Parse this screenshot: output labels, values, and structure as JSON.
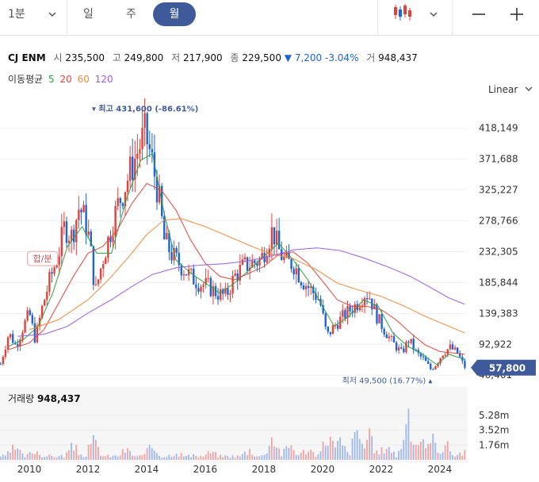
{
  "toolbar": {
    "interval_label": "1분",
    "periods": [
      "일",
      "주",
      "월"
    ],
    "active_period": "월"
  },
  "stock": {
    "name": "CJ ENM",
    "open_label": "시",
    "open": "235,500",
    "high_label": "고",
    "high": "249,800",
    "low_label": "저",
    "low": "217,900",
    "close_label": "종",
    "close": "229,500",
    "change": "▼ 7,200",
    "change_pct": "-3.04%",
    "volume_label": "거",
    "volume": "948,437"
  },
  "moving_average": {
    "label": "이동평균",
    "periods": [
      {
        "value": "5",
        "color": "#2e9e3e"
      },
      {
        "value": "20",
        "color": "#e0433c"
      },
      {
        "value": "60",
        "color": "#f2883a"
      },
      {
        "value": "120",
        "color": "#9a5ae0"
      }
    ]
  },
  "scale_label": "Linear",
  "colors": {
    "up": "#e0433c",
    "down": "#1e63d8",
    "current": "#3f5a9a",
    "volume_up": "#f0a4a4",
    "volume_down": "#9cb8ee"
  },
  "chart_data": {
    "type": "candlestick",
    "y_ticks": [
      "418,149",
      "371,688",
      "325,227",
      "278,766",
      "232,305",
      "185,844",
      "139,383",
      "92,922",
      "46,461"
    ],
    "y_tick_values": [
      418149,
      371688,
      325227,
      278766,
      232305,
      185844,
      139383,
      92922,
      46461
    ],
    "ylim": [
      36000,
      450000
    ],
    "x_ticks": [
      "2010",
      "2012",
      "2014",
      "2016",
      "2018",
      "2020",
      "2022",
      "2024"
    ],
    "x_tick_years": [
      2010,
      2012,
      2014,
      2016,
      2018,
      2020,
      2022,
      2024
    ],
    "xlim": [
      2009.0,
      2024.95
    ],
    "current_price": "57,800",
    "current_value": 57800,
    "max_annotation": "최고 431,600 (-86.61%)",
    "max_point": {
      "year": 2013.95,
      "value": 431600
    },
    "min_annotation": "최저 49,500 (16.77%)",
    "min_point": {
      "year": 2023.8,
      "value": 49500
    },
    "event_label": "합/분",
    "event_point": {
      "year": 2010.45,
      "value": 222000
    },
    "close_path": [
      [
        2009.0,
        60000
      ],
      [
        2009.3,
        110000
      ],
      [
        2009.55,
        90000
      ],
      [
        2009.8,
        120000
      ],
      [
        2010.0,
        140000
      ],
      [
        2010.2,
        100000
      ],
      [
        2010.45,
        150000
      ],
      [
        2010.7,
        190000
      ],
      [
        2011.0,
        230000
      ],
      [
        2011.2,
        270000
      ],
      [
        2011.45,
        255000
      ],
      [
        2011.7,
        300000
      ],
      [
        2011.9,
        280000
      ],
      [
        2012.05,
        250000
      ],
      [
        2012.25,
        170000
      ],
      [
        2012.5,
        220000
      ],
      [
        2012.75,
        260000
      ],
      [
        2013.0,
        300000
      ],
      [
        2013.25,
        330000
      ],
      [
        2013.5,
        360000
      ],
      [
        2013.75,
        390000
      ],
      [
        2013.95,
        410000
      ],
      [
        2014.15,
        375000
      ],
      [
        2014.4,
        320000
      ],
      [
        2014.6,
        250000
      ],
      [
        2014.9,
        225000
      ],
      [
        2015.2,
        210000
      ],
      [
        2015.5,
        195000
      ],
      [
        2015.8,
        185000
      ],
      [
        2016.1,
        180000
      ],
      [
        2016.4,
        170000
      ],
      [
        2016.7,
        165000
      ],
      [
        2017.0,
        195000
      ],
      [
        2017.3,
        210000
      ],
      [
        2017.6,
        215000
      ],
      [
        2017.9,
        220000
      ],
      [
        2018.1,
        245000
      ],
      [
        2018.3,
        265000
      ],
      [
        2018.5,
        235000
      ],
      [
        2018.75,
        215000
      ],
      [
        2019.0,
        215000
      ],
      [
        2019.3,
        190000
      ],
      [
        2019.6,
        175000
      ],
      [
        2019.9,
        160000
      ],
      [
        2020.15,
        105000
      ],
      [
        2020.4,
        120000
      ],
      [
        2020.7,
        135000
      ],
      [
        2020.95,
        145000
      ],
      [
        2021.2,
        155000
      ],
      [
        2021.45,
        170000
      ],
      [
        2021.6,
        165000
      ],
      [
        2021.85,
        135000
      ],
      [
        2022.1,
        115000
      ],
      [
        2022.4,
        95000
      ],
      [
        2022.7,
        80000
      ],
      [
        2022.95,
        100000
      ],
      [
        2023.2,
        80000
      ],
      [
        2023.45,
        70000
      ],
      [
        2023.7,
        55000
      ],
      [
        2023.9,
        65000
      ],
      [
        2024.1,
        80000
      ],
      [
        2024.35,
        88000
      ],
      [
        2024.6,
        80000
      ],
      [
        2024.85,
        57800
      ]
    ],
    "ma_series": [
      {
        "period": "5",
        "color": "#2e9e3e",
        "points": [
          [
            2009.3,
            90000
          ],
          [
            2009.8,
            100000
          ],
          [
            2010.3,
            120000
          ],
          [
            2010.8,
            170000
          ],
          [
            2011.3,
            240000
          ],
          [
            2011.8,
            270000
          ],
          [
            2012.3,
            230000
          ],
          [
            2012.8,
            230000
          ],
          [
            2013.3,
            310000
          ],
          [
            2013.8,
            370000
          ],
          [
            2014.2,
            380000
          ],
          [
            2014.6,
            290000
          ],
          [
            2015.0,
            220000
          ],
          [
            2015.5,
            200000
          ],
          [
            2016.0,
            185000
          ],
          [
            2016.5,
            170000
          ],
          [
            2017.0,
            185000
          ],
          [
            2017.5,
            205000
          ],
          [
            2018.0,
            225000
          ],
          [
            2018.5,
            245000
          ],
          [
            2019.0,
            220000
          ],
          [
            2019.5,
            190000
          ],
          [
            2020.0,
            150000
          ],
          [
            2020.4,
            120000
          ],
          [
            2020.9,
            135000
          ],
          [
            2021.4,
            160000
          ],
          [
            2021.9,
            150000
          ],
          [
            2022.4,
            110000
          ],
          [
            2022.9,
            90000
          ],
          [
            2023.4,
            78000
          ],
          [
            2023.9,
            62000
          ],
          [
            2024.3,
            78000
          ],
          [
            2024.85,
            70000
          ]
        ]
      },
      {
        "period": "20",
        "color": "#e0433c",
        "points": [
          [
            2009.3,
            85000
          ],
          [
            2010.0,
            95000
          ],
          [
            2010.5,
            115000
          ],
          [
            2011.0,
            155000
          ],
          [
            2011.5,
            195000
          ],
          [
            2012.0,
            230000
          ],
          [
            2012.5,
            240000
          ],
          [
            2013.0,
            265000
          ],
          [
            2013.5,
            305000
          ],
          [
            2014.0,
            335000
          ],
          [
            2014.5,
            325000
          ],
          [
            2015.0,
            295000
          ],
          [
            2015.5,
            250000
          ],
          [
            2016.0,
            215000
          ],
          [
            2016.5,
            195000
          ],
          [
            2017.0,
            190000
          ],
          [
            2017.5,
            200000
          ],
          [
            2018.0,
            210000
          ],
          [
            2018.5,
            228000
          ],
          [
            2019.0,
            232000
          ],
          [
            2019.5,
            215000
          ],
          [
            2020.0,
            188000
          ],
          [
            2020.5,
            160000
          ],
          [
            2021.0,
            150000
          ],
          [
            2021.5,
            150000
          ],
          [
            2022.0,
            145000
          ],
          [
            2022.5,
            130000
          ],
          [
            2023.0,
            110000
          ],
          [
            2023.5,
            92000
          ],
          [
            2024.0,
            82000
          ],
          [
            2024.85,
            78000
          ]
        ]
      },
      {
        "period": "60",
        "color": "#f2883a",
        "points": [
          [
            2010.0,
            115000
          ],
          [
            2011.0,
            130000
          ],
          [
            2012.0,
            160000
          ],
          [
            2012.7,
            190000
          ],
          [
            2013.4,
            225000
          ],
          [
            2014.0,
            258000
          ],
          [
            2014.6,
            280000
          ],
          [
            2015.2,
            282000
          ],
          [
            2016.0,
            270000
          ],
          [
            2016.8,
            255000
          ],
          [
            2017.6,
            240000
          ],
          [
            2018.3,
            228000
          ],
          [
            2019.0,
            222000
          ],
          [
            2019.8,
            205000
          ],
          [
            2020.5,
            185000
          ],
          [
            2021.2,
            175000
          ],
          [
            2022.0,
            165000
          ],
          [
            2022.8,
            150000
          ],
          [
            2023.5,
            135000
          ],
          [
            2024.2,
            122000
          ],
          [
            2024.85,
            110000
          ]
        ]
      },
      {
        "period": "120",
        "color": "#9a5ae0",
        "points": [
          [
            2009.6,
            105000
          ],
          [
            2010.5,
            108000
          ],
          [
            2011.3,
            120000
          ],
          [
            2012.0,
            140000
          ],
          [
            2012.8,
            160000
          ],
          [
            2013.5,
            180000
          ],
          [
            2014.2,
            198000
          ],
          [
            2015.0,
            208000
          ],
          [
            2015.8,
            212000
          ],
          [
            2016.6,
            214000
          ],
          [
            2017.4,
            218000
          ],
          [
            2018.2,
            225000
          ],
          [
            2019.0,
            235000
          ],
          [
            2019.8,
            238000
          ],
          [
            2020.6,
            234000
          ],
          [
            2021.4,
            223000
          ],
          [
            2022.2,
            210000
          ],
          [
            2023.0,
            195000
          ],
          [
            2023.7,
            178000
          ],
          [
            2024.3,
            163000
          ],
          [
            2024.85,
            153000
          ]
        ]
      }
    ],
    "volume": {
      "label": "거래량",
      "value": "948,437",
      "ticks": [
        "5.28m",
        "3.52m",
        "1.76m"
      ],
      "tick_values": [
        5.28,
        3.52,
        1.76
      ],
      "ylim": [
        0,
        6.6
      ],
      "peaks_m": [
        [
          2009.5,
          1.6
        ],
        [
          2010.2,
          1.2
        ],
        [
          2011.5,
          1.8
        ],
        [
          2012.2,
          2.6
        ],
        [
          2013.3,
          1.3
        ],
        [
          2014.2,
          1.8
        ],
        [
          2015.0,
          1.0
        ],
        [
          2016.2,
          0.9
        ],
        [
          2017.5,
          1.3
        ],
        [
          2018.3,
          3.5
        ],
        [
          2018.9,
          2.2
        ],
        [
          2019.5,
          1.6
        ],
        [
          2020.2,
          3.9
        ],
        [
          2020.6,
          2.6
        ],
        [
          2021.2,
          4.4
        ],
        [
          2021.6,
          3.1
        ],
        [
          2022.2,
          2.2
        ],
        [
          2022.9,
          5.9
        ],
        [
          2023.3,
          3.4
        ],
        [
          2023.8,
          3.0
        ],
        [
          2024.2,
          2.2
        ],
        [
          2024.8,
          1.0
        ]
      ]
    }
  }
}
